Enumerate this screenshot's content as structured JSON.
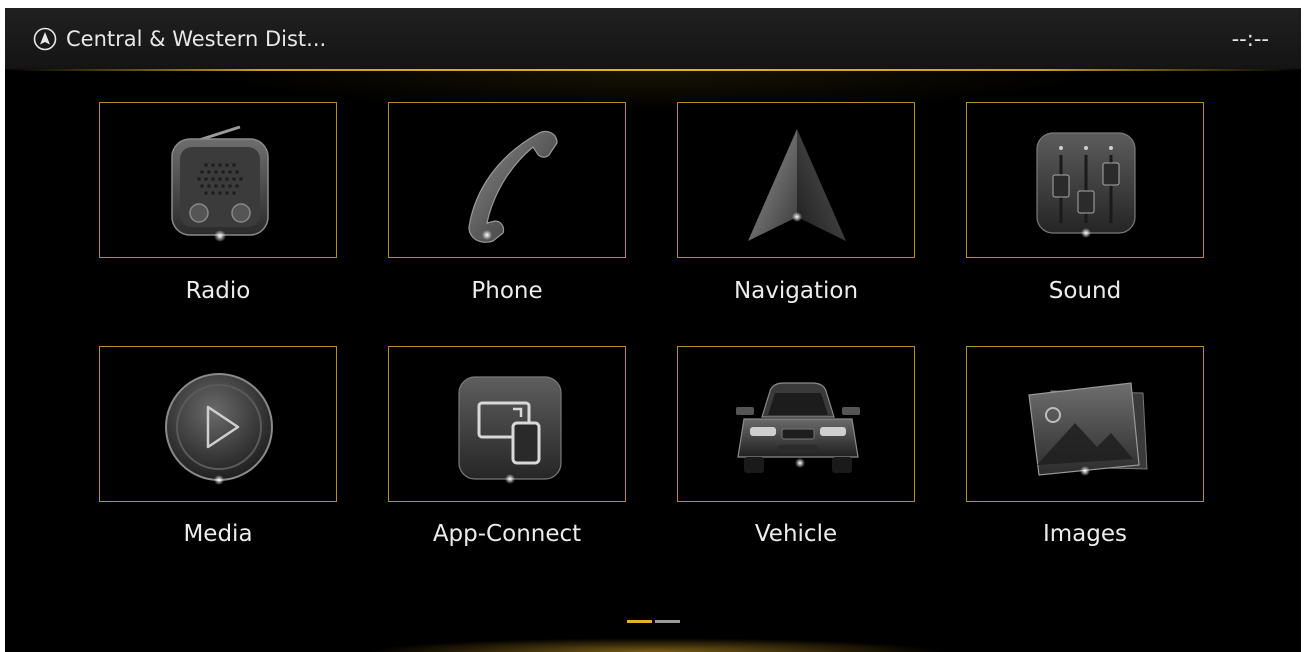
{
  "status_bar": {
    "location": "Central & Western Dist...",
    "location_icon": "compass-arrow-icon",
    "clock": "--:--"
  },
  "menu": {
    "items": [
      {
        "label": "Radio",
        "icon": "radio-icon"
      },
      {
        "label": "Phone",
        "icon": "phone-handset-icon"
      },
      {
        "label": "Navigation",
        "icon": "navigation-arrow-icon"
      },
      {
        "label": "Sound",
        "icon": "equalizer-sliders-icon"
      },
      {
        "label": "Media",
        "icon": "play-icon"
      },
      {
        "label": "App-Connect",
        "icon": "screen-mirroring-icon"
      },
      {
        "label": "Vehicle",
        "icon": "car-icon"
      },
      {
        "label": "Images",
        "icon": "photo-gallery-icon"
      }
    ]
  },
  "pager": {
    "pages": 2,
    "current": 1
  },
  "colors": {
    "accent": "#e2b51e",
    "tile_border": "#b58e1c",
    "background": "#000000",
    "text": "#ececec"
  }
}
